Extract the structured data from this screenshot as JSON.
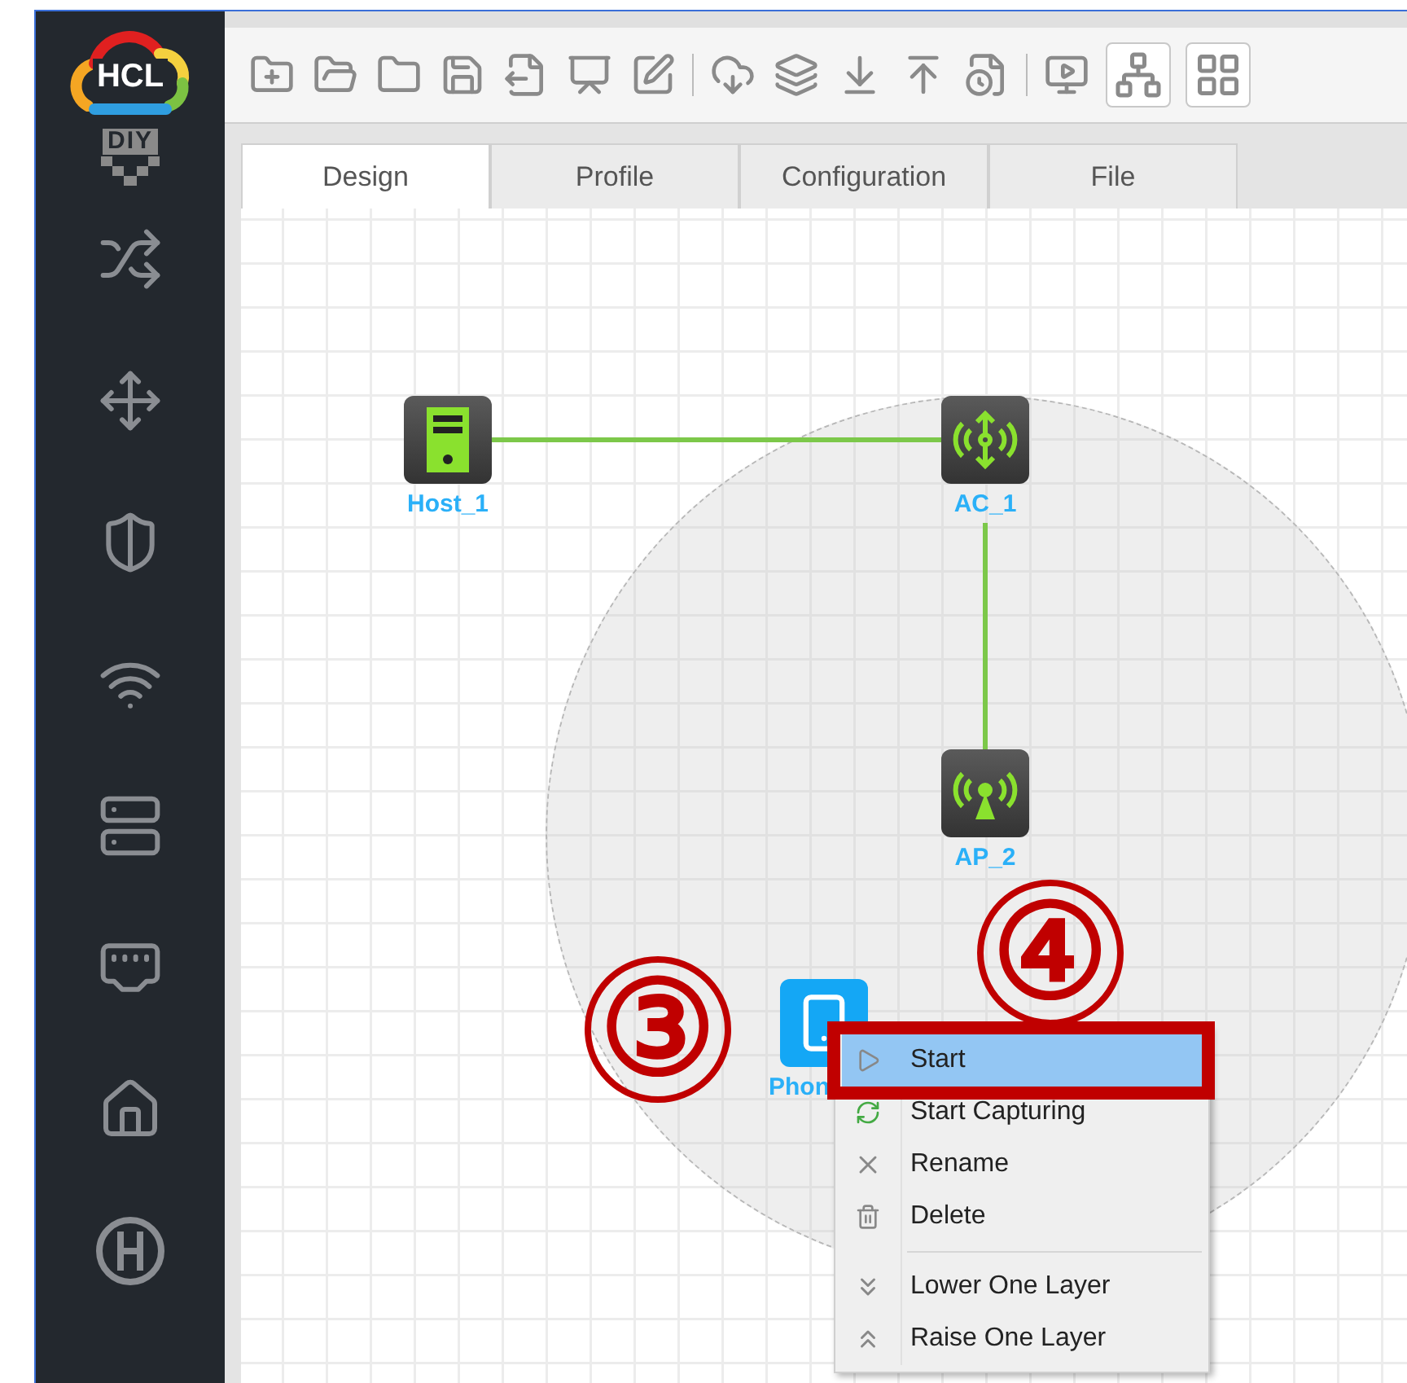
{
  "logo": {
    "text": "HCL"
  },
  "sidebar": {
    "diy_label": "DIY"
  },
  "tabs": [
    {
      "label": "Design",
      "selected": true
    },
    {
      "label": "Profile",
      "selected": false
    },
    {
      "label": "Configuration",
      "selected": false
    },
    {
      "label": "File",
      "selected": false
    }
  ],
  "canvas": {
    "nodes": [
      {
        "kind": "host",
        "label": "Host_1"
      },
      {
        "kind": "ac",
        "label": "AC_1"
      },
      {
        "kind": "ap",
        "label": "AP_2"
      },
      {
        "kind": "phone",
        "label": "Phon"
      }
    ]
  },
  "context_menu": {
    "groups": [
      {
        "items": [
          {
            "kind": "start",
            "label": "Start",
            "selected": true
          },
          {
            "kind": "capture",
            "label": "Start Capturing",
            "selected": false
          },
          {
            "kind": "rename",
            "label": "Rename",
            "selected": false
          },
          {
            "kind": "delete",
            "label": "Delete",
            "selected": false
          }
        ]
      },
      {
        "items": [
          {
            "kind": "lower",
            "label": "Lower One Layer",
            "selected": false
          },
          {
            "kind": "raise",
            "label": "Raise One Layer",
            "selected": false
          }
        ]
      }
    ]
  },
  "annotations": [
    {
      "text": "③"
    },
    {
      "text": "④"
    }
  ]
}
